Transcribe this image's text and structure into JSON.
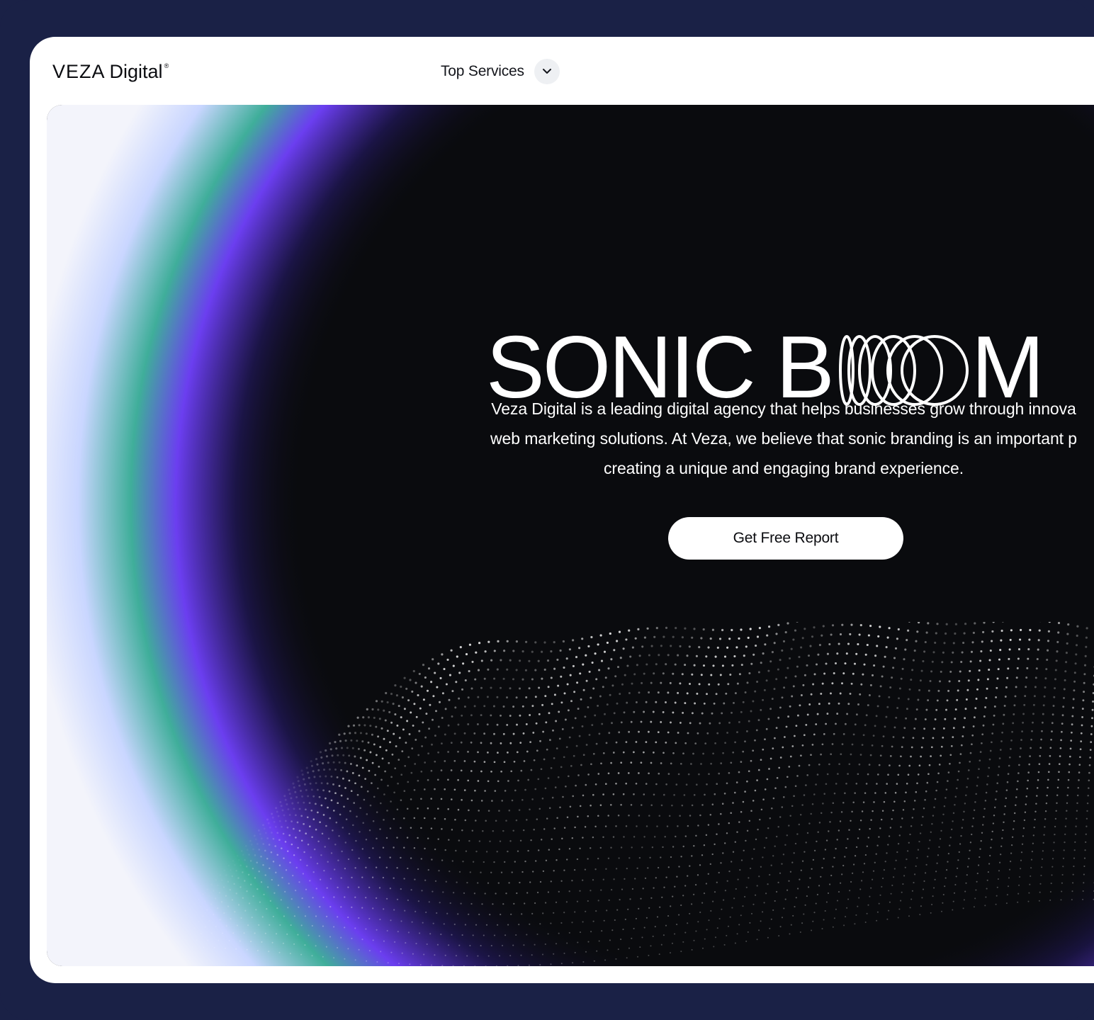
{
  "nav": {
    "logo_word": "VEZA",
    "logo_sub": "Digital",
    "logo_reg": "®",
    "services_label": "Top Services"
  },
  "hero": {
    "title_pre": "SONIC B",
    "title_post": "M",
    "description_lines": [
      "Veza Digital is a leading digital agency that helps businesses grow through innova",
      "web marketing solutions. At Veza, we believe that sonic branding is an important p",
      "creating a unique and engaging brand experience."
    ],
    "cta_label": "Get Free Report"
  },
  "colors": {
    "frame": "#1a2146",
    "hero_bg": "#0a0b0e",
    "glow_purple": "#6b3ef0",
    "glow_teal": "#3fae9a",
    "button_bg": "#ffffff"
  },
  "icons": [
    "chevron-down-icon",
    "sonic-rings-icon"
  ]
}
